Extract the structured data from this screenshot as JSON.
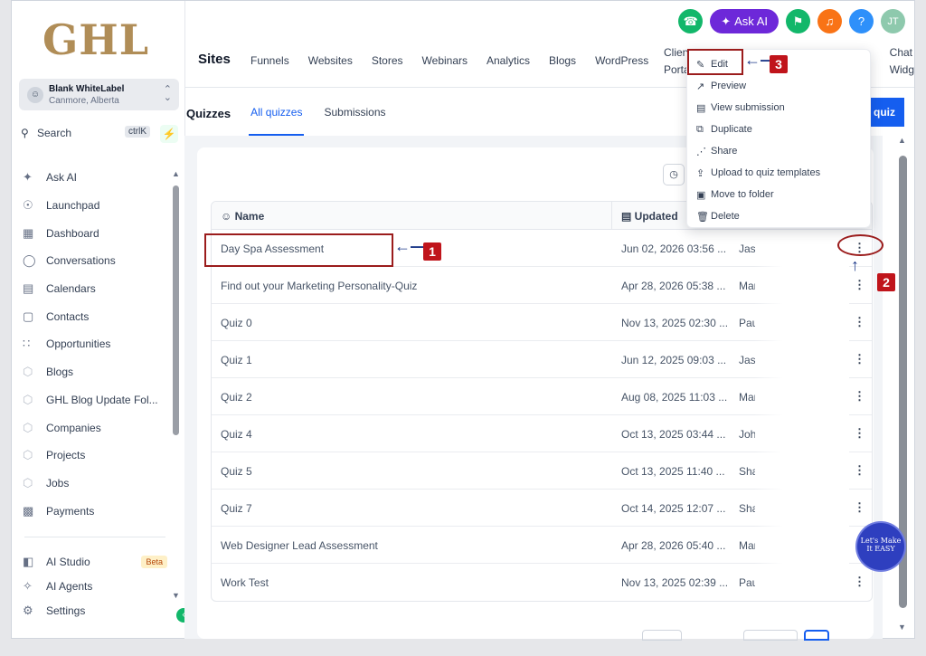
{
  "sidebar": {
    "logo": "GHL",
    "account": {
      "name": "Blank WhiteLabel",
      "location": "Canmore, Alberta"
    },
    "search": {
      "label": "Search",
      "shortcut": "ctrlK"
    },
    "items": [
      {
        "label": "Ask AI",
        "icon": "sparkle-icon"
      },
      {
        "label": "Launchpad",
        "icon": "rocket-icon"
      },
      {
        "label": "Dashboard",
        "icon": "grid-icon"
      },
      {
        "label": "Conversations",
        "icon": "chat-icon"
      },
      {
        "label": "Calendars",
        "icon": "calendar-icon"
      },
      {
        "label": "Contacts",
        "icon": "contacts-icon"
      },
      {
        "label": "Opportunities",
        "icon": "pipeline-icon"
      },
      {
        "label": "Blogs",
        "icon": "cube-icon"
      },
      {
        "label": "GHL Blog Update Fol...",
        "icon": "cube-icon"
      },
      {
        "label": "Companies",
        "icon": "cube-icon"
      },
      {
        "label": "Projects",
        "icon": "cube-icon"
      },
      {
        "label": "Jobs",
        "icon": "cube-icon"
      },
      {
        "label": "Payments",
        "icon": "receipt-icon"
      }
    ],
    "items2": [
      {
        "label": "AI Studio",
        "icon": "ai-studio-icon",
        "badge": "Beta"
      },
      {
        "label": "AI Agents",
        "icon": "sparkle-icon"
      },
      {
        "label": "Settings",
        "icon": "gear-icon"
      }
    ]
  },
  "topbar": {
    "ask_ai": "Ask AI",
    "avatar": "JT",
    "help": "?",
    "site_title": "Sites",
    "nav": [
      "Funnels",
      "Websites",
      "Stores",
      "Webinars",
      "Analytics",
      "Blogs",
      "WordPress"
    ],
    "nav_more": [
      "Client",
      "Porta"
    ],
    "nav_right": [
      "Chat",
      "Widg"
    ]
  },
  "subheader": {
    "title": "Quizzes",
    "tabs": [
      "All quizzes",
      "Submissions"
    ],
    "new_button": "quiz"
  },
  "table": {
    "headers": {
      "name": "Name",
      "updated": "Updated"
    },
    "rows": [
      {
        "name": "Day Spa Assessment",
        "date": "Jun 02, 2026 03:56 ...",
        "user": "Jasr"
      },
      {
        "name": "Find out your Marketing Personality-Quiz",
        "date": "Apr 28, 2026 05:38 ...",
        "user": "Mar"
      },
      {
        "name": "Quiz 0",
        "date": "Nov 13, 2025 02:30 ...",
        "user": "Pau"
      },
      {
        "name": "Quiz 1",
        "date": "Jun 12, 2025 09:03 ...",
        "user": "Jasr"
      },
      {
        "name": "Quiz 2",
        "date": "Aug 08, 2025 11:03 ...",
        "user": "Mar"
      },
      {
        "name": "Quiz 4",
        "date": "Oct 13, 2025 03:44 ...",
        "user": "Joh"
      },
      {
        "name": "Quiz 5",
        "date": "Oct 13, 2025 11:40 ...",
        "user": "Sha"
      },
      {
        "name": "Quiz 7",
        "date": "Oct 14, 2025 12:07 ...",
        "user": "Sha"
      },
      {
        "name": "Web Designer Lead Assessment",
        "date": "Apr 28, 2026 05:40 ...",
        "user": "Mar"
      },
      {
        "name": "Work Test",
        "date": "Nov 13, 2025 02:39 ...",
        "user": "Pau"
      }
    ]
  },
  "menu": [
    {
      "label": "Edit",
      "icon": "pencil-icon"
    },
    {
      "label": "Preview",
      "icon": "external-link-icon"
    },
    {
      "label": "View submission",
      "icon": "document-icon"
    },
    {
      "label": "Duplicate",
      "icon": "copy-icon"
    },
    {
      "label": "Share",
      "icon": "share-icon"
    },
    {
      "label": "Upload to quiz templates",
      "icon": "upload-icon"
    },
    {
      "label": "Move to folder",
      "icon": "folder-icon"
    },
    {
      "label": "Delete",
      "icon": "trash-icon"
    }
  ],
  "annotations": [
    "1",
    "2",
    "3"
  ],
  "watermark": "Let's Make It EASY",
  "colors": {
    "accent": "#155eef",
    "brand_gold": "#b08d57",
    "ask_ai": "#6d28d9",
    "annotation_red": "#9b1c1c",
    "annotation_arrow": "#1d3a8a"
  }
}
